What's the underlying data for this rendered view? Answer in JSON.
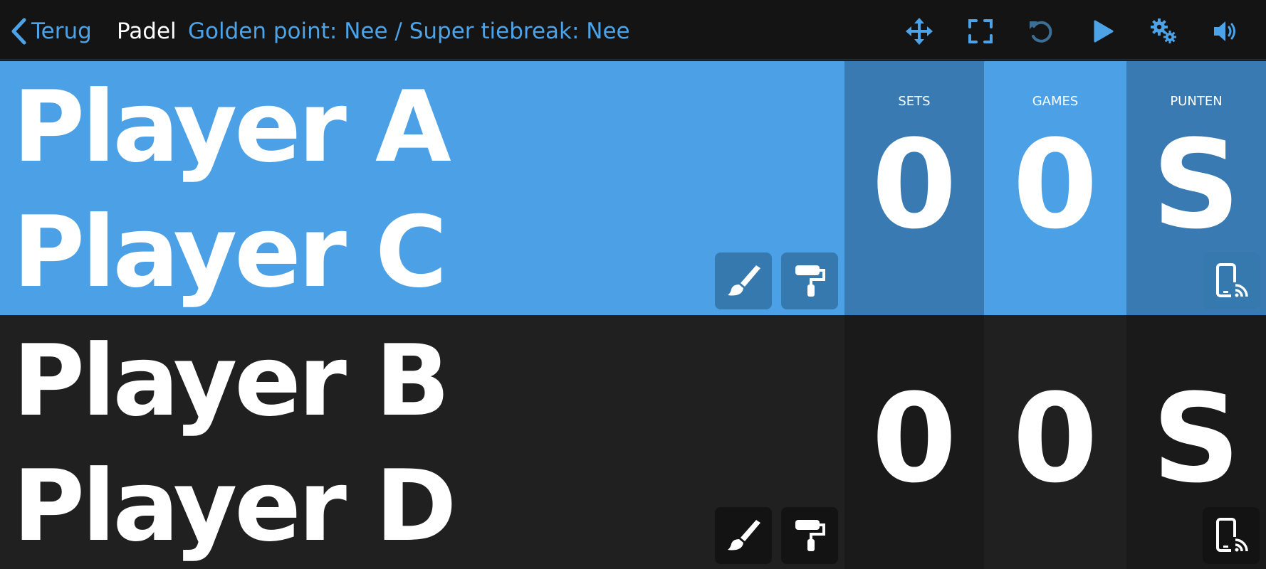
{
  "header": {
    "back_label": "Terug",
    "title": "Padel",
    "subtitle": "Golden point: Nee / Super tiebreak: Nee",
    "accent_color": "#4da3e8",
    "icons": [
      "move-icon",
      "fullscreen-icon",
      "undo-icon",
      "play-icon",
      "settings-icon",
      "volume-icon"
    ]
  },
  "columns": {
    "sets": "SETS",
    "games": "GAMES",
    "points": "PUNTEN"
  },
  "teams": [
    {
      "player1": "Player A",
      "player2": "Player C",
      "sets": "0",
      "games": "0",
      "points": "S",
      "color": "#4ca1e6"
    },
    {
      "player1": "Player B",
      "player2": "Player D",
      "sets": "0",
      "games": "0",
      "points": "S",
      "color": "#202020"
    }
  ]
}
